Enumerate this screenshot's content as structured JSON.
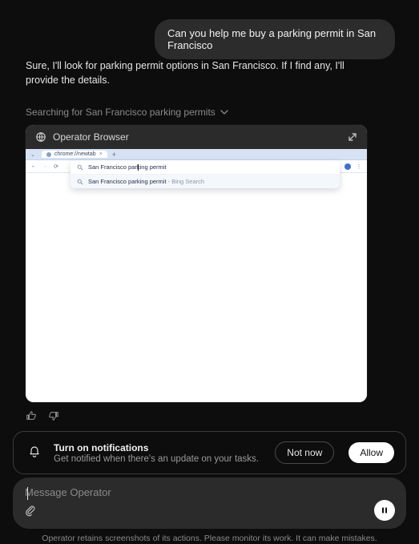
{
  "user_message": "Can you help me buy a parking permit in San Francisco",
  "assistant_message": "Sure, I'll look for parking permit options in San Francisco. If I find any, I'll provide the details.",
  "status_line": "Searching for San Francisco parking permits",
  "browser": {
    "title": "Operator Browser",
    "tab_label": "chrome://newtab",
    "omnibox_value": "San Francisco parking permit",
    "suggestion_main": "San Francisco parking permit",
    "suggestion_suffix": " - Bing Search"
  },
  "notifications": {
    "title": "Turn on notifications",
    "subtitle": "Get notified when there's an update on your tasks.",
    "not_now": "Not now",
    "allow": "Allow"
  },
  "composer": {
    "placeholder": "Message Operator"
  },
  "footnote": "Operator retains screenshots of its actions. Please monitor its work. It can make mistakes."
}
